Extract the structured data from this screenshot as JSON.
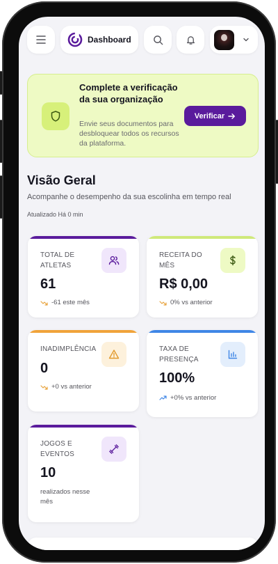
{
  "header": {
    "dashboard_label": "Dashboard"
  },
  "banner": {
    "title": "Complete a verificação da sua organização",
    "description": "Envie seus documentos para desbloquear todos os recursos da plataforma.",
    "button_label": "Verificar"
  },
  "overview": {
    "title": "Visão Geral",
    "subtitle": "Acompanhe o desempenho da sua escolinha em tempo real",
    "updated": "Atualizado Há 0 min"
  },
  "stats": [
    {
      "label": "TOTAL DE ATLETAS",
      "value": "61",
      "trend": "-61 este mês",
      "bar_color": "#5a1b9c",
      "icon": "users-icon",
      "icon_bg": "#f0e6fb",
      "icon_color": "#5a1b9c",
      "trend_color": "#e8a33d"
    },
    {
      "label": "RECEITA DO MÊS",
      "value": "R$ 0,00",
      "trend": "0% vs anterior",
      "bar_color": "#cfe97a",
      "icon": "dollar-icon",
      "icon_bg": "#eefac4",
      "icon_color": "#3c5a12",
      "trend_color": "#e8a33d"
    },
    {
      "label": "INADIMPLÊNCIA",
      "value": "0",
      "trend": "+0 vs anterior",
      "bar_color": "#f0a33a",
      "icon": "warning-icon",
      "icon_bg": "#fdf1dc",
      "icon_color": "#e29a2c",
      "trend_color": "#e8a33d"
    },
    {
      "label": "TAXA DE PRESENÇA",
      "value": "100%",
      "trend": "+0% vs anterior",
      "bar_color": "#3f86e6",
      "icon": "chart-icon",
      "icon_bg": "#e3eefc",
      "icon_color": "#3f86e6",
      "trend_color": "#3f86e6"
    },
    {
      "label": "JOGOS E EVENTOS",
      "value": "10",
      "note": "realizados nesse mês",
      "bar_color": "#5a1b9c",
      "icon": "dumbbell-icon",
      "icon_bg": "#f0e6fb",
      "icon_color": "#5a1b9c"
    }
  ]
}
